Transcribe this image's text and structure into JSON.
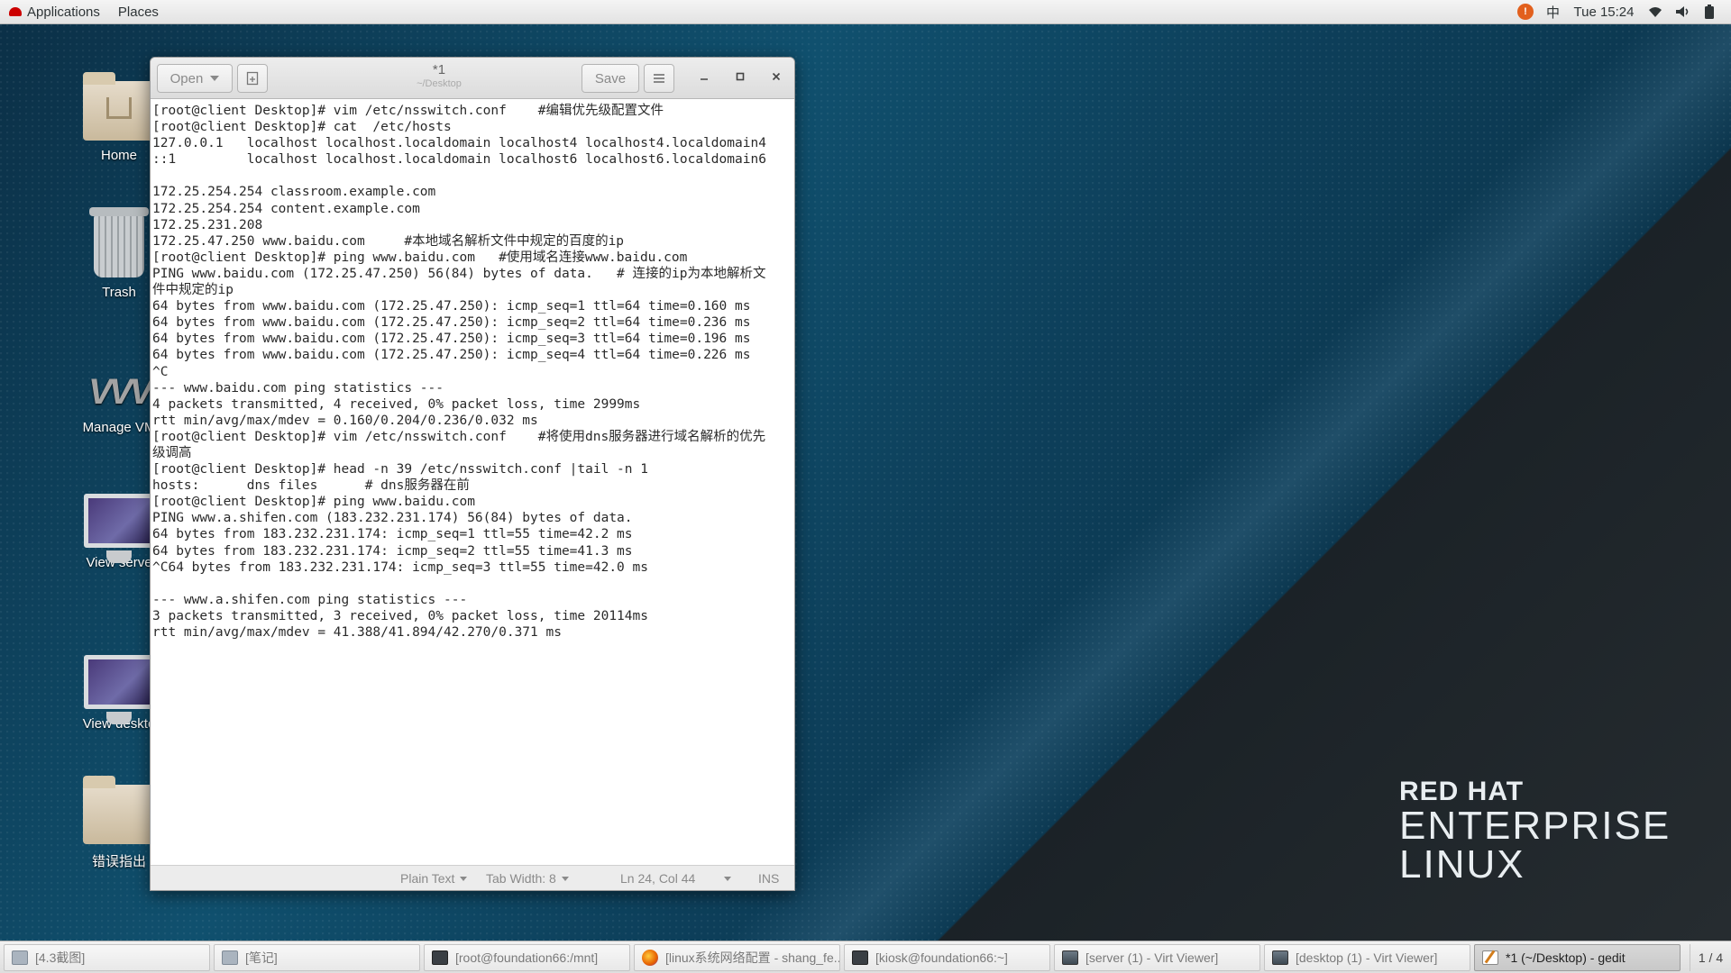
{
  "topbar": {
    "applications": "Applications",
    "places": "Places",
    "input_method": "中",
    "clock": "Tue 15:24"
  },
  "desktop_icons": [
    {
      "label": "Home"
    },
    {
      "label": "Trash"
    },
    {
      "label": "Manage VM"
    },
    {
      "label": "View serve"
    },
    {
      "label": "View deskto"
    },
    {
      "label": "错误指出"
    }
  ],
  "brand": {
    "line1": "RED HAT",
    "line2": "ENTERPRISE",
    "line3": "LINUX"
  },
  "gedit": {
    "open_label": "Open",
    "save_label": "Save",
    "title": "*1",
    "subtitle": "~/Desktop",
    "lines": [
      "[root@client Desktop]# vim /etc/nsswitch.conf    #编辑优先级配置文件",
      "[root@client Desktop]# cat  /etc/hosts",
      "127.0.0.1   localhost localhost.localdomain localhost4 localhost4.localdomain4",
      "::1         localhost localhost.localdomain localhost6 localhost6.localdomain6",
      "",
      "172.25.254.254 classroom.example.com",
      "172.25.254.254 content.example.com",
      "172.25.231.208",
      "172.25.47.250 www.baidu.com     #本地域名解析文件中规定的百度的ip",
      "[root@client Desktop]# ping www.baidu.com   #使用域名连接www.baidu.com",
      "PING www.baidu.com (172.25.47.250) 56(84) bytes of data.   # 连接的ip为本地解析文",
      "件中规定的ip",
      "64 bytes from www.baidu.com (172.25.47.250): icmp_seq=1 ttl=64 time=0.160 ms",
      "64 bytes from www.baidu.com (172.25.47.250): icmp_seq=2 ttl=64 time=0.236 ms",
      "64 bytes from www.baidu.com (172.25.47.250): icmp_seq=3 ttl=64 time=0.196 ms",
      "64 bytes from www.baidu.com (172.25.47.250): icmp_seq=4 ttl=64 time=0.226 ms",
      "^C",
      "--- www.baidu.com ping statistics ---",
      "4 packets transmitted, 4 received, 0% packet loss, time 2999ms",
      "rtt min/avg/max/mdev = 0.160/0.204/0.236/0.032 ms",
      "[root@client Desktop]# vim /etc/nsswitch.conf    #将使用dns服务器进行域名解析的优先",
      "级调高",
      "[root@client Desktop]# head -n 39 /etc/nsswitch.conf |tail -n 1",
      "hosts:      dns files      # dns服务器在前",
      "[root@client Desktop]# ping www.baidu.com",
      "PING www.a.shifen.com (183.232.231.174) 56(84) bytes of data.",
      "64 bytes from 183.232.231.174: icmp_seq=1 ttl=55 time=42.2 ms",
      "64 bytes from 183.232.231.174: icmp_seq=2 ttl=55 time=41.3 ms",
      "^C64 bytes from 183.232.231.174: icmp_seq=3 ttl=55 time=42.0 ms",
      "",
      "--- www.a.shifen.com ping statistics ---",
      "3 packets transmitted, 3 received, 0% packet loss, time 20114ms",
      "rtt min/avg/max/mdev = 41.388/41.894/42.270/0.371 ms"
    ],
    "status": {
      "language": "Plain Text",
      "tab_width": "Tab Width: 8",
      "position": "Ln 24, Col 44",
      "mode": "INS"
    }
  },
  "taskbar": {
    "items": [
      {
        "label": "[4.3截图]",
        "icon": "document-icon",
        "active": false
      },
      {
        "label": "[笔记]",
        "icon": "document-icon",
        "active": false
      },
      {
        "label": "[root@foundation66:/mnt]",
        "icon": "terminal-icon",
        "active": false
      },
      {
        "label": "[linux系统网络配置 - shang_fe...",
        "icon": "firefox-icon",
        "active": false
      },
      {
        "label": "[kiosk@foundation66:~]",
        "icon": "terminal-icon",
        "active": false
      },
      {
        "label": "[server (1) - Virt Viewer]",
        "icon": "virt-viewer-icon",
        "active": false
      },
      {
        "label": "[desktop (1) - Virt Viewer]",
        "icon": "virt-viewer-icon",
        "active": false
      },
      {
        "label": "*1 (~/Desktop) - gedit",
        "icon": "gedit-icon",
        "active": true
      }
    ],
    "workspace": "1 / 4"
  }
}
